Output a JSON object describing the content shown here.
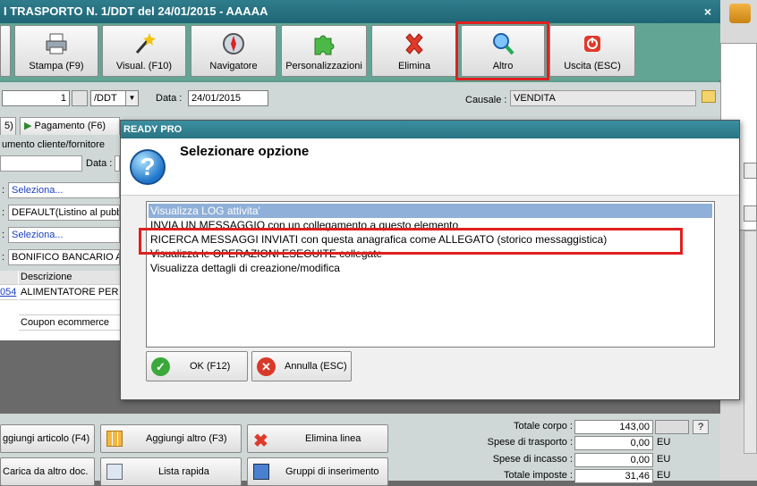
{
  "window": {
    "title": "I TRASPORTO N. 1/DDT del 24/01/2015 - AAAAA",
    "close_glyph": "×"
  },
  "toolbar": {
    "buttons": [
      {
        "label": "Stampa (F9)",
        "icon": "printer-icon"
      },
      {
        "label": "Visual. (F10)",
        "icon": "magic-wand-icon"
      },
      {
        "label": "Navigatore",
        "icon": "compass-icon"
      },
      {
        "label": "Personalizzazioni",
        "icon": "puzzle-icon"
      },
      {
        "label": "Elimina",
        "icon": "red-x-icon"
      },
      {
        "label": "Altro",
        "icon": "magnifier-icon"
      },
      {
        "label": "Uscita (ESC)",
        "icon": "power-icon"
      }
    ]
  },
  "header_fields": {
    "number": "1",
    "series": "/DDT",
    "data_label": "Data :",
    "data_value": "24/01/2015",
    "causale_label": "Causale :",
    "causale_value": "VENDITA"
  },
  "tabs": {
    "tab_left": "5)",
    "tab_pagamento": "Pagamento (F6)"
  },
  "form": {
    "doc_label": "umento cliente/fornitore",
    "data_label": "Data :",
    "rows": [
      "Seleziona...",
      "DEFAULT(Listino al pubbli",
      "Seleziona...",
      "BONIFICO BANCARIO AN"
    ]
  },
  "grid": {
    "header": "Descrizione",
    "rows": [
      {
        "code": "054",
        "desc": "ALIMENTATORE PER N"
      },
      {
        "code": "",
        "desc": ""
      },
      {
        "code": "",
        "desc": "Coupon ecommerce"
      }
    ]
  },
  "bottom_buttons": [
    {
      "label": "ggiungi articolo (F4)"
    },
    {
      "label": "Aggiungi altro (F3)"
    },
    {
      "label": "Elimina linea"
    },
    {
      "label": "Carica da altro doc."
    },
    {
      "label": "Lista rapida"
    },
    {
      "label": "Gruppi di inserimento"
    }
  ],
  "totals": [
    {
      "label": "Totale corpo :",
      "value": "143,00",
      "unit": ""
    },
    {
      "label": "Spese di trasporto :",
      "value": "0,00",
      "unit": "EU"
    },
    {
      "label": "Spese di incasso :",
      "value": "0,00",
      "unit": "EU"
    },
    {
      "label": "Totale imposte :",
      "value": "31,46",
      "unit": "EU"
    }
  ],
  "totals_help": "?",
  "dialog": {
    "title": "READY PRO",
    "heading": "Selezionare opzione",
    "options": [
      "Visualizza LOG attivita'",
      "INVIA UN MESSAGGIO con un collegamento a questo elemento",
      "RICERCA MESSAGGI INVIATI con questa anagrafica come ALLEGATO (storico messaggistica)",
      "Visualizza le OPERAZIONI ESEGUITE collegate",
      "Visualizza dettagli di creazione/modifica"
    ],
    "selected_index": 0,
    "ok_label": "OK (F12)",
    "cancel_label": "Annulla (ESC)"
  },
  "colors": {
    "highlight": "#e02020",
    "window_bg": "#5f9c8e",
    "selection": "#8fb0d8"
  }
}
